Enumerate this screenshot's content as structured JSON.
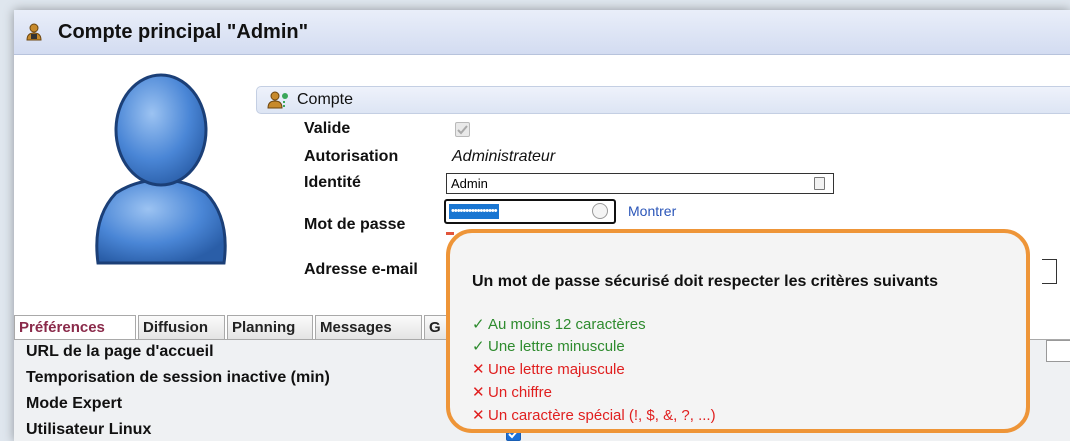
{
  "window": {
    "title": "Compte principal \"Admin\"",
    "icon": "user-lock-icon"
  },
  "section": {
    "title": "Compte",
    "icon": "users-icon"
  },
  "fields": {
    "valide": {
      "label": "Valide",
      "checked": true
    },
    "autorisation": {
      "label": "Autorisation",
      "value": "Administrateur"
    },
    "identite": {
      "label": "Identité",
      "value": "Admin"
    },
    "mot_de_passe": {
      "label": "Mot de passe",
      "masked": "••••••••••••••••",
      "show_link": "Montrer"
    },
    "email": {
      "label": "Adresse e-mail"
    }
  },
  "tabs": [
    "Préférences",
    "Diffusion",
    "Planning",
    "Messages",
    "G"
  ],
  "active_tab": "Préférences",
  "preferences": {
    "url": "URL de la page d'accueil",
    "timeout": "Temporisation de session inactive (min)",
    "expert": "Mode Expert",
    "linux": "Utilisateur Linux",
    "linux_checked": true
  },
  "password_tooltip": {
    "heading": "Un mot de passe sécurisé doit respecter les critères suivants",
    "criteria": [
      {
        "text": "Au moins 12 caractères",
        "met": true,
        "mark": "✓"
      },
      {
        "text": "Une lettre minuscule",
        "met": true,
        "mark": "✓"
      },
      {
        "text": "Une lettre majuscule",
        "met": false,
        "mark": "✕"
      },
      {
        "text": "Un chiffre",
        "met": false,
        "mark": "✕"
      },
      {
        "text": "Un caractère spécial (!, $, &, ?, ...)",
        "met": false,
        "mark": "✕"
      }
    ],
    "border_color": "#ee9538",
    "ok_color": "#2e8b2e",
    "ko_color": "#e01f1f"
  }
}
